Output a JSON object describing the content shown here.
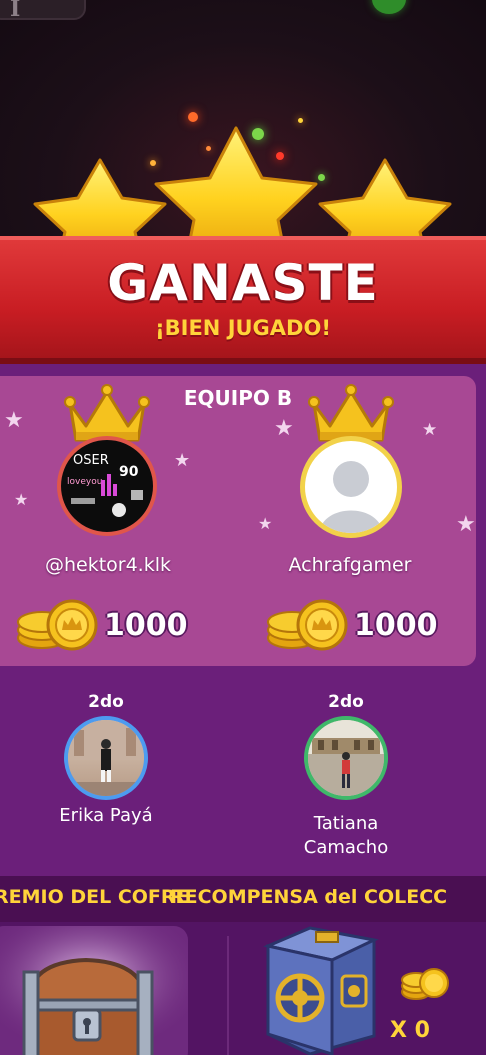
{
  "banner": {
    "title": "GANASTE",
    "subtitle": "¡BIEN JUGADO!"
  },
  "team": {
    "title": "EQUIPO B",
    "players": [
      {
        "name": "@hektor4.klk",
        "coins": "1000"
      },
      {
        "name": "Achrafgamer",
        "coins": "1000"
      }
    ]
  },
  "opponents": [
    {
      "rank": "2do",
      "name": "Erika Payá"
    },
    {
      "rank": "2do",
      "name_line1": "Tatiana",
      "name_line2": "Camacho"
    }
  ],
  "prizes": {
    "chest_label": "REMIO DEL COFRE",
    "collection_label": "RECOMPENSA del COLECC",
    "collection_count": "X 0"
  },
  "avatar_text": {
    "words": [
      "OSER",
      "90",
      "loveyou"
    ]
  },
  "colors": {
    "banner_red": "#c81d23",
    "gold": "#ffd43a",
    "panel_purple": "#a84894",
    "background_purple": "#6b1f7a"
  },
  "icons": {
    "stars": "star-icon",
    "crown": "crown-icon",
    "coin": "coin-stack-icon",
    "chest": "treasure-chest-icon",
    "vault": "vault-icon"
  }
}
